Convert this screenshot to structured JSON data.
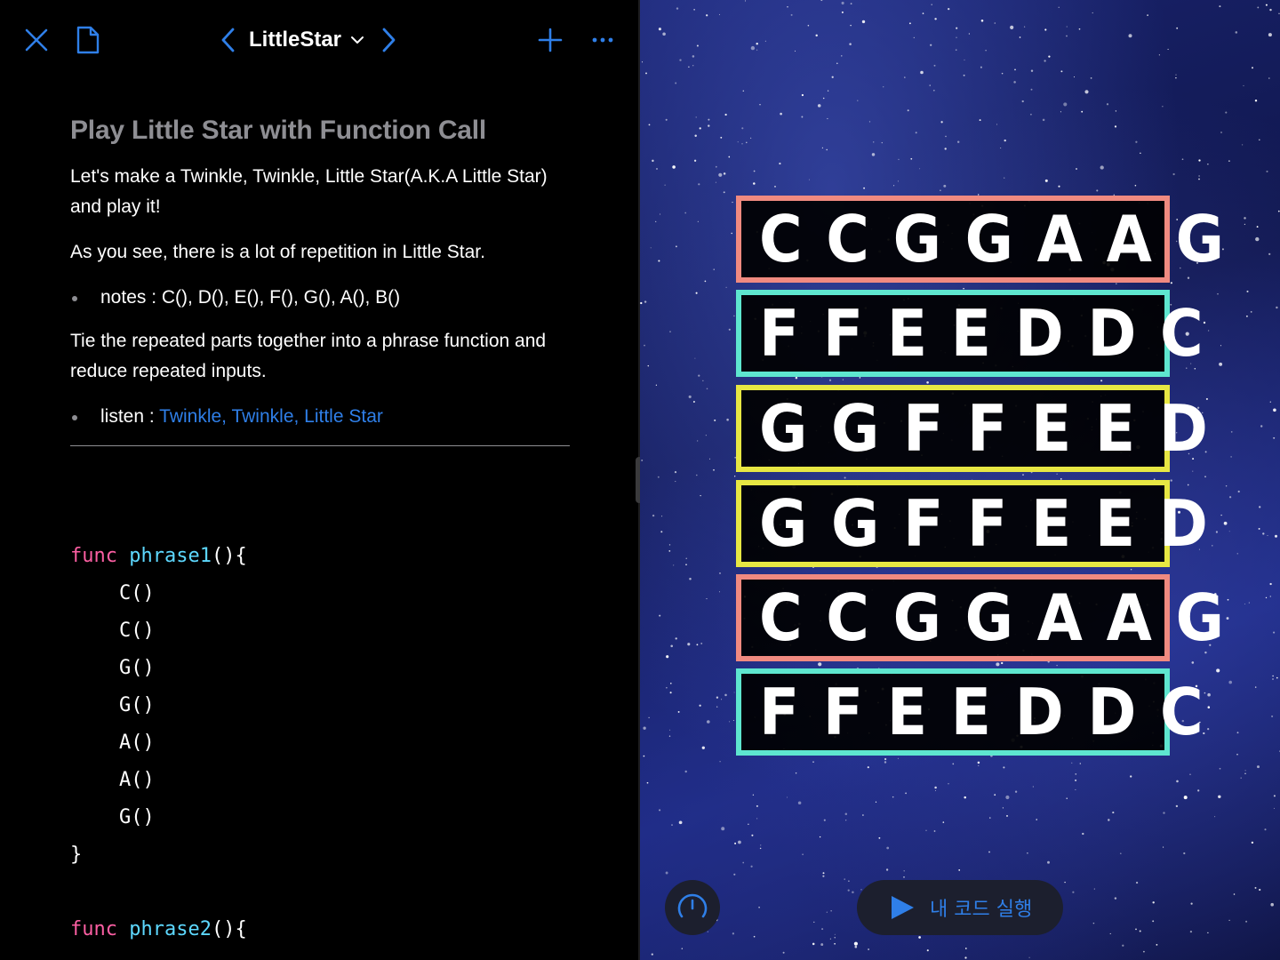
{
  "toolbar": {
    "title": "LittleStar"
  },
  "doc": {
    "heading": "Play Little Star with Function Call",
    "para1": "Let's make a Twinkle, Twinkle, Little Star(A.K.A Little Star) and play it!",
    "para2": "As you see, there is a lot of repetition in Little Star.",
    "bullet1": "notes : C(), D(), E(), F(), G(), A(), B()",
    "para3": "Tie the repeated parts together into a phrase function and reduce repeated inputs.",
    "bullet2_prefix": "listen : ",
    "bullet2_link": "Twinkle, Twinkle, Little Star"
  },
  "code": {
    "phrase1": {
      "keyword": "func",
      "name": "phrase1",
      "open": "(){",
      "calls": [
        "C()",
        "C()",
        "G()",
        "G()",
        "A()",
        "A()",
        "G()"
      ],
      "close": "}"
    },
    "phrase2": {
      "keyword": "func",
      "name": "phrase2",
      "open": "(){"
    }
  },
  "live_view": {
    "rows": [
      {
        "notes": "CCGGAAG",
        "color": "#f08a80"
      },
      {
        "notes": "FFEEDDC",
        "color": "#5ee6cf"
      },
      {
        "notes": "GGFFEED",
        "color": "#e7e743"
      },
      {
        "notes": "GGFFEED",
        "color": "#e7e743"
      },
      {
        "notes": "CCGGAAG",
        "color": "#f08a80"
      },
      {
        "notes": "FFEEDDC",
        "color": "#5ee6cf"
      }
    ]
  },
  "controls": {
    "run_label": "내 코드 실행"
  },
  "colors": {
    "accent": "#2f7fe8",
    "keyword": "#fc5fa3",
    "function_name": "#5dd8ff"
  }
}
